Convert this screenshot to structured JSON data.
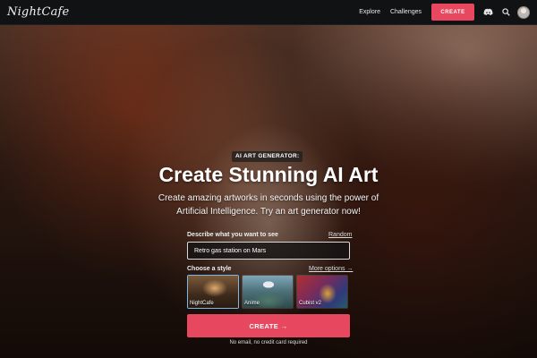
{
  "nav": {
    "logo_text": "NightCafe",
    "explore_label": "Explore",
    "challenges_label": "Challenges",
    "create_label": "CREATE",
    "icons": {
      "discord": "discord-icon",
      "search": "search-icon",
      "avatar": "avatar"
    }
  },
  "hero": {
    "badge": "AI ART GENERATOR:",
    "headline": "Create Stunning AI Art",
    "subtitle_line1": "Create amazing artworks in seconds using the power of",
    "subtitle_line2": "Artificial Intelligence. Try an art generator now!"
  },
  "prompt": {
    "label": "Describe what you want to see",
    "random_link": "Random",
    "value": "Retro gas station on Mars"
  },
  "styles": {
    "label": "Choose a style",
    "more_options": "More options →",
    "items": [
      {
        "name": "NightCafe",
        "selected": true
      },
      {
        "name": "Anime",
        "selected": false
      },
      {
        "name": "Cubist v2",
        "selected": false
      }
    ]
  },
  "cta": {
    "create_label": "CREATE →",
    "fine_print": "No email, no credit card required"
  },
  "colors": {
    "accent": "#e8485f",
    "nav_bg": "#111214",
    "selected_border": "#7fb6e8"
  }
}
